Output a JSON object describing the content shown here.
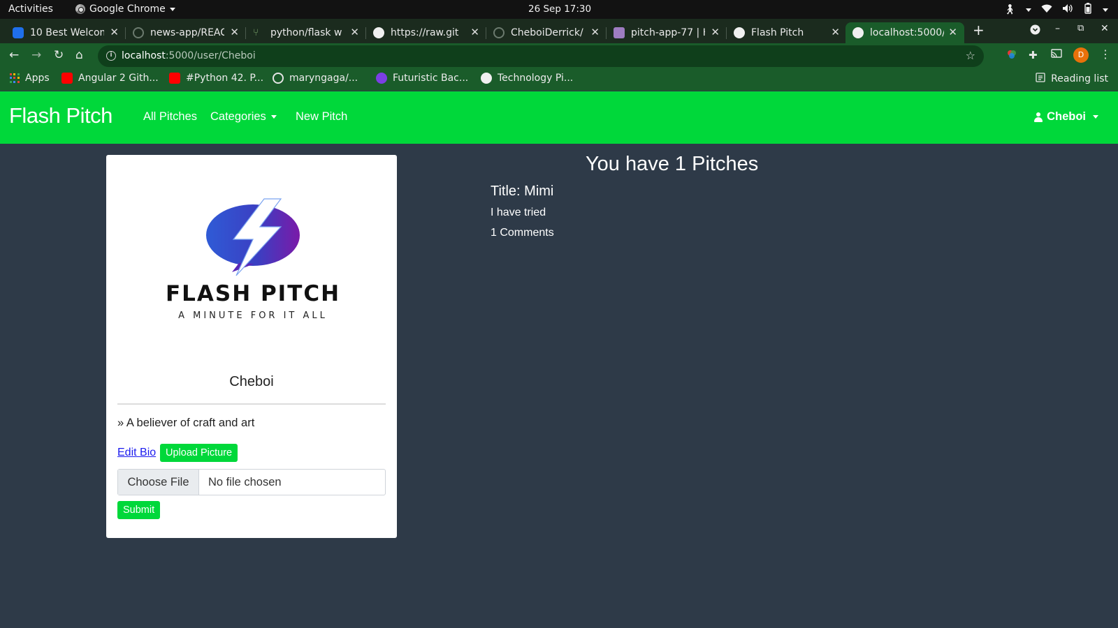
{
  "system_bar": {
    "activities": "Activities",
    "app_name": "Google Chrome",
    "clock": "26 Sep  17:30"
  },
  "tabs": [
    {
      "title": "10 Best Welcom",
      "favicon_color": "#1f6feb"
    },
    {
      "title": "news-app/REAC",
      "favicon_color": "#24292e"
    },
    {
      "title": "python/flask w",
      "favicon_color": "#5a7d4f"
    },
    {
      "title": "https://raw.git",
      "favicon_color": "#ffffff"
    },
    {
      "title": "CheboiDerrick/",
      "favicon_color": "#24292e"
    },
    {
      "title": "pitch-app-77 | H",
      "favicon_color": "#9e7cc1"
    },
    {
      "title": "Flash Pitch",
      "favicon_color": "#ffffff"
    },
    {
      "title": "localhost:5000/",
      "favicon_color": "#ffffff"
    }
  ],
  "toolbar": {
    "url_host": "localhost",
    "url_path": ":5000/user/Cheboi",
    "profile_initial": "D"
  },
  "bookmarks": {
    "items": [
      {
        "label": "Apps"
      },
      {
        "label": "Angular 2 Gith..."
      },
      {
        "label": "#Python 42. P..."
      },
      {
        "label": "maryngaga/..."
      },
      {
        "label": "Futuristic Bac..."
      },
      {
        "label": "Technology Pi..."
      }
    ],
    "reading_list": "Reading list"
  },
  "navbar": {
    "brand": "Flash Pitch",
    "links": [
      "All Pitches",
      "Categories",
      "New Pitch"
    ],
    "user": "Cheboi",
    "bg_color": "#00d83a"
  },
  "profile": {
    "logo_name": "FLASH PITCH",
    "logo_tagline": "A MINUTE FOR IT ALL",
    "username": "Cheboi",
    "bio": "» A believer of craft and art",
    "edit_bio": "Edit Bio",
    "upload_button": "Upload Picture",
    "choose_file": "Choose File",
    "no_file": "No file chosen",
    "submit": "Submit"
  },
  "pitches": {
    "heading": "You have 1 Pitches",
    "items": [
      {
        "title": "Title: Mimi",
        "body": "I have tried",
        "comments": "1 Comments"
      }
    ]
  }
}
